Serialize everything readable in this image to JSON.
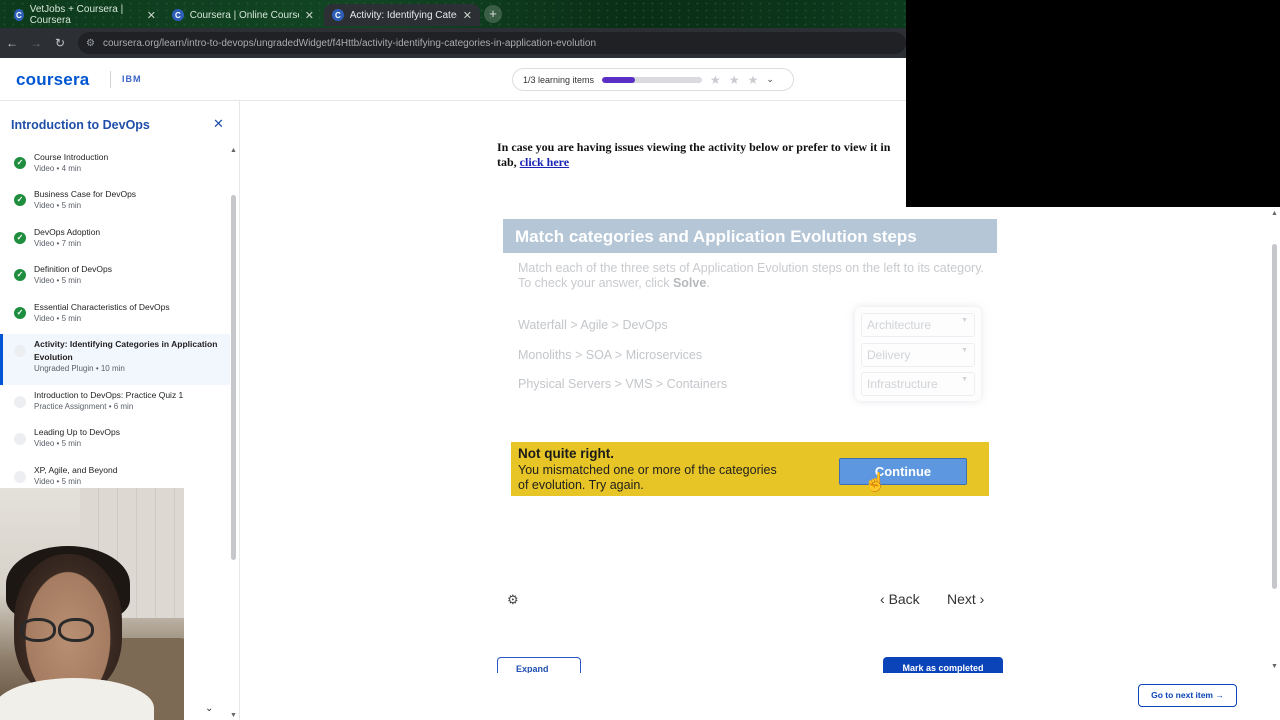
{
  "browser": {
    "tabs": [
      {
        "label": "VetJobs + Coursera | Coursera"
      },
      {
        "label": "Coursera | Online Courses From"
      },
      {
        "label": "Activity: Identifying Categories"
      }
    ],
    "new_tab": "+",
    "url": "coursera.org/learn/intro-to-devops/ungradedWidget/f4Httb/activity-identifying-categories-in-application-evolution"
  },
  "header": {
    "logo": "coursera",
    "partner": "IBM",
    "progress_label": "1/3 learning items",
    "progress_fraction": 0.33
  },
  "sidebar": {
    "title": "Introduction to DevOps",
    "items": [
      {
        "name": "Course Introduction",
        "meta": "Video • 4 min",
        "done": true
      },
      {
        "name": "Business Case for DevOps",
        "meta": "Video • 5 min",
        "done": true
      },
      {
        "name": "DevOps Adoption",
        "meta": "Video • 7 min",
        "done": true
      },
      {
        "name": "Definition of DevOps",
        "meta": "Video • 5 min",
        "done": true
      },
      {
        "name": "Essential Characteristics of DevOps",
        "meta": "Video • 5 min",
        "done": true
      },
      {
        "name": "Activity: Identifying Categories in Application Evolution",
        "meta": "Ungraded Plugin • 10 min",
        "done": false,
        "active": true
      },
      {
        "name": "Introduction to DevOps: Practice Quiz 1",
        "meta": "Practice Assignment • 6 min",
        "done": false
      },
      {
        "name": "Leading Up to DevOps",
        "meta": "Video • 5 min",
        "done": false
      },
      {
        "name": "XP, Agile, and Beyond",
        "meta": "Video • 5 min",
        "done": false
      }
    ]
  },
  "notice": {
    "text": "In case you are having issues viewing the activity below or prefer to view it in",
    "text2": "tab,",
    "link": "click here"
  },
  "activity": {
    "title": "Match categories and Application Evolution steps",
    "desc_prefix": "Match each of the three sets of Application Evolution steps on the left to its category. To check your answer, click",
    "desc_bold": "Solve",
    "steps": [
      "Waterfall > Agile > DevOps",
      "Monoliths > SOA > Microservices",
      "Physical Servers > VMS > Containers"
    ],
    "selects": [
      "Architecture",
      "Delivery",
      "Infrastructure"
    ],
    "feedback_title": "Not quite right.",
    "feedback_text": "You mismatched one or more of the categories of evolution. Try again.",
    "continue_label": "Continue"
  },
  "footer_nav": {
    "back": "Back",
    "next": "Next",
    "expand": "Expand",
    "mark_complete": "Mark as completed",
    "go_next": "Go to next item"
  }
}
